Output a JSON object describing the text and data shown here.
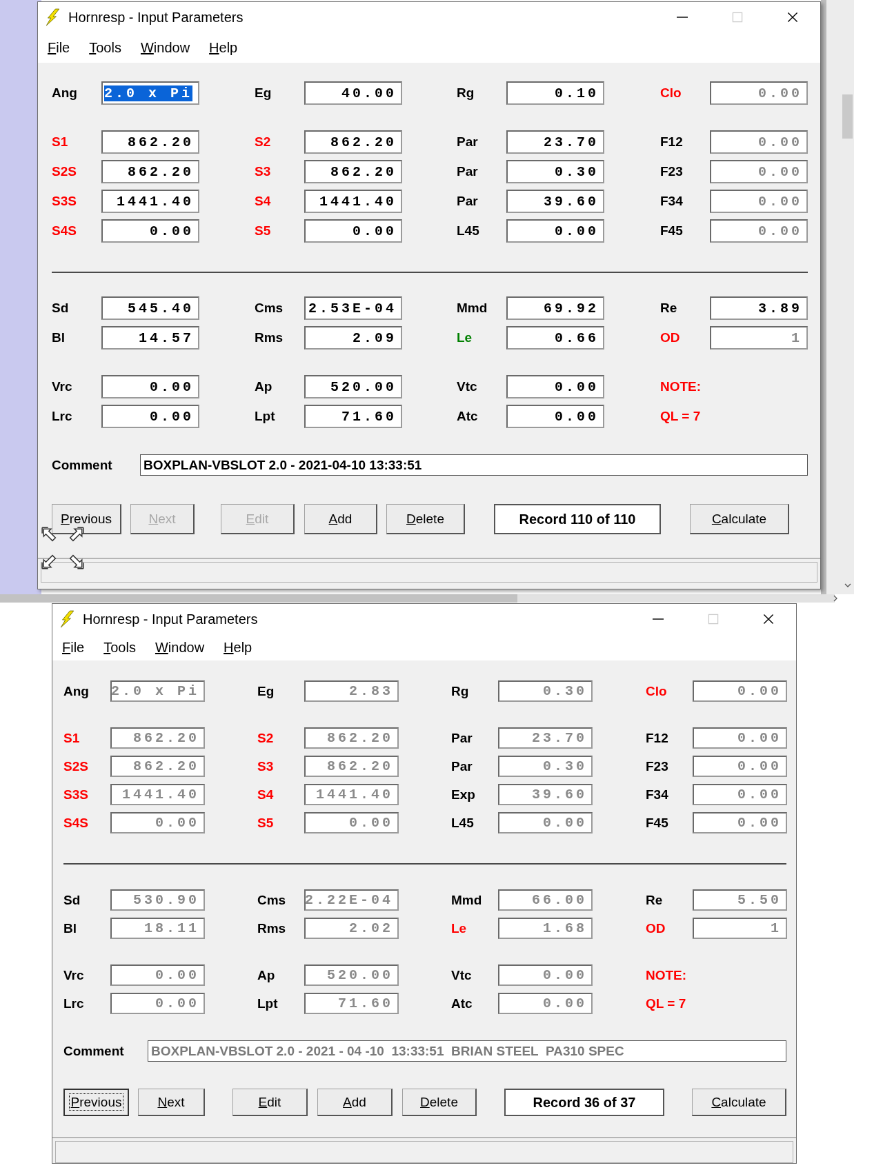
{
  "windows": [
    {
      "title": "Hornresp - Input Parameters",
      "menu": [
        "File",
        "Tools",
        "Window",
        "Help"
      ],
      "blocks": [
        {
          "kind": "rows",
          "rows": [
            [
              {
                "kind": "field",
                "label": "Ang",
                "color": "#000000",
                "value": "2.0 x Pi",
                "disabled": false,
                "highlighted": true
              },
              {
                "kind": "field",
                "label": "Eg",
                "color": "#000000",
                "value": "40.00",
                "disabled": false,
                "highlighted": false
              },
              {
                "kind": "field",
                "label": "Rg",
                "color": "#000000",
                "value": "0.10",
                "disabled": false,
                "highlighted": false
              },
              {
                "kind": "field",
                "label": "Clo",
                "color": "#ff0000",
                "value": "0.00",
                "disabled": true,
                "highlighted": false
              }
            ]
          ]
        },
        {
          "kind": "rows",
          "rows": [
            [
              {
                "kind": "field",
                "label": "S1",
                "color": "#ff0000",
                "value": "862.20",
                "disabled": false,
                "highlighted": false
              },
              {
                "kind": "field",
                "label": "S2",
                "color": "#ff0000",
                "value": "862.20",
                "disabled": false,
                "highlighted": false
              },
              {
                "kind": "field",
                "label": "Par",
                "color": "#000000",
                "value": "23.70",
                "disabled": false,
                "highlighted": false
              },
              {
                "kind": "field",
                "label": "F12",
                "color": "#000000",
                "value": "0.00",
                "disabled": true,
                "highlighted": false
              }
            ],
            [
              {
                "kind": "field",
                "label": "S2S",
                "color": "#ff0000",
                "value": "862.20",
                "disabled": false,
                "highlighted": false
              },
              {
                "kind": "field",
                "label": "S3",
                "color": "#ff0000",
                "value": "862.20",
                "disabled": false,
                "highlighted": false
              },
              {
                "kind": "field",
                "label": "Par",
                "color": "#000000",
                "value": "0.30",
                "disabled": false,
                "highlighted": false
              },
              {
                "kind": "field",
                "label": "F23",
                "color": "#000000",
                "value": "0.00",
                "disabled": true,
                "highlighted": false
              }
            ],
            [
              {
                "kind": "field",
                "label": "S3S",
                "color": "#ff0000",
                "value": "1441.40",
                "disabled": false,
                "highlighted": false
              },
              {
                "kind": "field",
                "label": "S4",
                "color": "#ff0000",
                "value": "1441.40",
                "disabled": false,
                "highlighted": false
              },
              {
                "kind": "field",
                "label": "Par",
                "color": "#000000",
                "value": "39.60",
                "disabled": false,
                "highlighted": false
              },
              {
                "kind": "field",
                "label": "F34",
                "color": "#000000",
                "value": "0.00",
                "disabled": true,
                "highlighted": false
              }
            ],
            [
              {
                "kind": "field",
                "label": "S4S",
                "color": "#ff0000",
                "value": "0.00",
                "disabled": false,
                "highlighted": false
              },
              {
                "kind": "field",
                "label": "S5",
                "color": "#ff0000",
                "value": "0.00",
                "disabled": false,
                "highlighted": false
              },
              {
                "kind": "field",
                "label": "L45",
                "color": "#000000",
                "value": "0.00",
                "disabled": false,
                "highlighted": false
              },
              {
                "kind": "field",
                "label": "F45",
                "color": "#000000",
                "value": "0.00",
                "disabled": true,
                "highlighted": false
              }
            ]
          ]
        },
        {
          "kind": "divider"
        },
        {
          "kind": "rows",
          "rows": [
            [
              {
                "kind": "field",
                "label": "Sd",
                "color": "#000000",
                "value": "545.40",
                "disabled": false,
                "highlighted": false
              },
              {
                "kind": "field",
                "label": "Cms",
                "color": "#000000",
                "value": "2.53E-04",
                "disabled": false,
                "highlighted": false
              },
              {
                "kind": "field",
                "label": "Mmd",
                "color": "#000000",
                "value": "69.92",
                "disabled": false,
                "highlighted": false
              },
              {
                "kind": "field",
                "label": "Re",
                "color": "#000000",
                "value": "3.89",
                "disabled": false,
                "highlighted": false
              }
            ],
            [
              {
                "kind": "field",
                "label": "Bl",
                "color": "#000000",
                "value": "14.57",
                "disabled": false,
                "highlighted": false
              },
              {
                "kind": "field",
                "label": "Rms",
                "color": "#000000",
                "value": "2.09",
                "disabled": false,
                "highlighted": false
              },
              {
                "kind": "field",
                "label": "Le",
                "color": "#008000",
                "value": "0.66",
                "disabled": false,
                "highlighted": false
              },
              {
                "kind": "field",
                "label": "OD",
                "color": "#ff0000",
                "value": "1",
                "disabled": true,
                "highlighted": false
              }
            ]
          ]
        },
        {
          "kind": "rows",
          "rows": [
            [
              {
                "kind": "field",
                "label": "Vrc",
                "color": "#000000",
                "value": "0.00",
                "disabled": false,
                "highlighted": false
              },
              {
                "kind": "field",
                "label": "Ap",
                "color": "#000000",
                "value": "520.00",
                "disabled": false,
                "highlighted": false
              },
              {
                "kind": "field",
                "label": "Vtc",
                "color": "#000000",
                "value": "0.00",
                "disabled": false,
                "highlighted": false
              },
              {
                "kind": "note",
                "label": "NOTE:",
                "color": "#ff0000"
              }
            ],
            [
              {
                "kind": "field",
                "label": "Lrc",
                "color": "#000000",
                "value": "0.00",
                "disabled": false,
                "highlighted": false
              },
              {
                "kind": "field",
                "label": "Lpt",
                "color": "#000000",
                "value": "71.60",
                "disabled": false,
                "highlighted": false
              },
              {
                "kind": "field",
                "label": "Atc",
                "color": "#000000",
                "value": "0.00",
                "disabled": false,
                "highlighted": false
              },
              {
                "kind": "note",
                "label": "QL = 7",
                "color": "#ff0000"
              }
            ]
          ]
        }
      ],
      "comment": {
        "label": "Comment",
        "value": "BOXPLAN-VBSLOT 2.0 - 2021-04-10 13:33:51",
        "disabled": false
      },
      "buttons": [
        {
          "kind": "button",
          "label": "Previous",
          "disabled": false,
          "focused": false
        },
        {
          "kind": "button",
          "label": "Next",
          "disabled": true,
          "focused": false
        },
        {
          "kind": "button",
          "label": "Edit",
          "disabled": true,
          "focused": false
        },
        {
          "kind": "button",
          "label": "Add",
          "disabled": false,
          "focused": false
        },
        {
          "kind": "button",
          "label": "Delete",
          "disabled": false,
          "focused": false
        },
        {
          "kind": "counter",
          "label": "Record 110 of 110"
        },
        {
          "kind": "button",
          "label": "Calculate",
          "disabled": false,
          "focused": false
        }
      ]
    },
    {
      "title": "Hornresp - Input Parameters",
      "menu": [
        "File",
        "Tools",
        "Window",
        "Help"
      ],
      "blocks": [
        {
          "kind": "rows",
          "rows": [
            [
              {
                "kind": "field",
                "label": "Ang",
                "color": "#000000",
                "value": "2.0 x Pi",
                "disabled": true,
                "highlighted": false
              },
              {
                "kind": "field",
                "label": "Eg",
                "color": "#000000",
                "value": "2.83",
                "disabled": true,
                "highlighted": false
              },
              {
                "kind": "field",
                "label": "Rg",
                "color": "#000000",
                "value": "0.30",
                "disabled": true,
                "highlighted": false
              },
              {
                "kind": "field",
                "label": "Clo",
                "color": "#ff0000",
                "value": "0.00",
                "disabled": true,
                "highlighted": false
              }
            ]
          ]
        },
        {
          "kind": "rows",
          "rows": [
            [
              {
                "kind": "field",
                "label": "S1",
                "color": "#ff0000",
                "value": "862.20",
                "disabled": true,
                "highlighted": false
              },
              {
                "kind": "field",
                "label": "S2",
                "color": "#ff0000",
                "value": "862.20",
                "disabled": true,
                "highlighted": false
              },
              {
                "kind": "field",
                "label": "Par",
                "color": "#000000",
                "value": "23.70",
                "disabled": true,
                "highlighted": false
              },
              {
                "kind": "field",
                "label": "F12",
                "color": "#000000",
                "value": "0.00",
                "disabled": true,
                "highlighted": false
              }
            ],
            [
              {
                "kind": "field",
                "label": "S2S",
                "color": "#ff0000",
                "value": "862.20",
                "disabled": true,
                "highlighted": false
              },
              {
                "kind": "field",
                "label": "S3",
                "color": "#ff0000",
                "value": "862.20",
                "disabled": true,
                "highlighted": false
              },
              {
                "kind": "field",
                "label": "Par",
                "color": "#000000",
                "value": "0.30",
                "disabled": true,
                "highlighted": false
              },
              {
                "kind": "field",
                "label": "F23",
                "color": "#000000",
                "value": "0.00",
                "disabled": true,
                "highlighted": false
              }
            ],
            [
              {
                "kind": "field",
                "label": "S3S",
                "color": "#ff0000",
                "value": "1441.40",
                "disabled": true,
                "highlighted": false
              },
              {
                "kind": "field",
                "label": "S4",
                "color": "#ff0000",
                "value": "1441.40",
                "disabled": true,
                "highlighted": false
              },
              {
                "kind": "field",
                "label": "Exp",
                "color": "#000000",
                "value": "39.60",
                "disabled": true,
                "highlighted": false
              },
              {
                "kind": "field",
                "label": "F34",
                "color": "#000000",
                "value": "0.00",
                "disabled": true,
                "highlighted": false
              }
            ],
            [
              {
                "kind": "field",
                "label": "S4S",
                "color": "#ff0000",
                "value": "0.00",
                "disabled": true,
                "highlighted": false
              },
              {
                "kind": "field",
                "label": "S5",
                "color": "#ff0000",
                "value": "0.00",
                "disabled": true,
                "highlighted": false
              },
              {
                "kind": "field",
                "label": "L45",
                "color": "#000000",
                "value": "0.00",
                "disabled": true,
                "highlighted": false
              },
              {
                "kind": "field",
                "label": "F45",
                "color": "#000000",
                "value": "0.00",
                "disabled": true,
                "highlighted": false
              }
            ]
          ]
        },
        {
          "kind": "divider"
        },
        {
          "kind": "rows",
          "rows": [
            [
              {
                "kind": "field",
                "label": "Sd",
                "color": "#000000",
                "value": "530.90",
                "disabled": true,
                "highlighted": false
              },
              {
                "kind": "field",
                "label": "Cms",
                "color": "#000000",
                "value": "2.22E-04",
                "disabled": true,
                "highlighted": false
              },
              {
                "kind": "field",
                "label": "Mmd",
                "color": "#000000",
                "value": "66.00",
                "disabled": true,
                "highlighted": false
              },
              {
                "kind": "field",
                "label": "Re",
                "color": "#000000",
                "value": "5.50",
                "disabled": true,
                "highlighted": false
              }
            ],
            [
              {
                "kind": "field",
                "label": "Bl",
                "color": "#000000",
                "value": "18.11",
                "disabled": true,
                "highlighted": false
              },
              {
                "kind": "field",
                "label": "Rms",
                "color": "#000000",
                "value": "2.02",
                "disabled": true,
                "highlighted": false
              },
              {
                "kind": "field",
                "label": "Le",
                "color": "#ff0000",
                "value": "1.68",
                "disabled": true,
                "highlighted": false
              },
              {
                "kind": "field",
                "label": "OD",
                "color": "#ff0000",
                "value": "1",
                "disabled": true,
                "highlighted": false
              }
            ]
          ]
        },
        {
          "kind": "rows",
          "rows": [
            [
              {
                "kind": "field",
                "label": "Vrc",
                "color": "#000000",
                "value": "0.00",
                "disabled": true,
                "highlighted": false
              },
              {
                "kind": "field",
                "label": "Ap",
                "color": "#000000",
                "value": "520.00",
                "disabled": true,
                "highlighted": false
              },
              {
                "kind": "field",
                "label": "Vtc",
                "color": "#000000",
                "value": "0.00",
                "disabled": true,
                "highlighted": false
              },
              {
                "kind": "note",
                "label": "NOTE:",
                "color": "#ff0000"
              }
            ],
            [
              {
                "kind": "field",
                "label": "Lrc",
                "color": "#000000",
                "value": "0.00",
                "disabled": true,
                "highlighted": false
              },
              {
                "kind": "field",
                "label": "Lpt",
                "color": "#000000",
                "value": "71.60",
                "disabled": true,
                "highlighted": false
              },
              {
                "kind": "field",
                "label": "Atc",
                "color": "#000000",
                "value": "0.00",
                "disabled": true,
                "highlighted": false
              },
              {
                "kind": "note",
                "label": "QL = 7",
                "color": "#ff0000"
              }
            ]
          ]
        }
      ],
      "comment": {
        "label": "Comment",
        "value": "BOXPLAN-VBSLOT 2.0 - 2021 - 04 -10  13:33:51  BRIAN STEEL  PA310 SPEC",
        "disabled": true
      },
      "buttons": [
        {
          "kind": "button",
          "label": "Previous",
          "disabled": false,
          "focused": true
        },
        {
          "kind": "button",
          "label": "Next",
          "disabled": false,
          "focused": false
        },
        {
          "kind": "button",
          "label": "Edit",
          "disabled": false,
          "focused": false
        },
        {
          "kind": "button",
          "label": "Add",
          "disabled": false,
          "focused": false
        },
        {
          "kind": "button",
          "label": "Delete",
          "disabled": false,
          "focused": false
        },
        {
          "kind": "counter",
          "label": "Record 36 of 37"
        },
        {
          "kind": "button",
          "label": "Calculate",
          "disabled": false,
          "focused": false
        }
      ]
    }
  ]
}
